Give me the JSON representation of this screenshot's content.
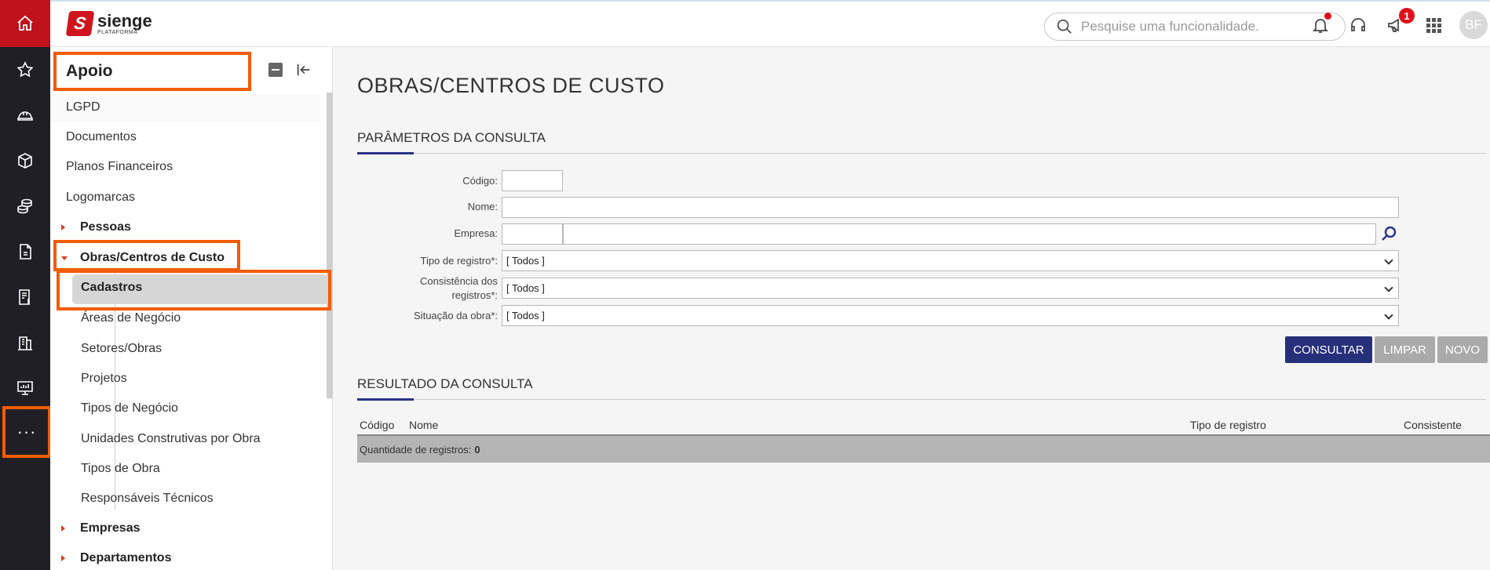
{
  "app": {
    "logo_name": "sienge",
    "logo_sub": "PLATAFORMA",
    "logo_mark": "S"
  },
  "rail": {
    "icons": [
      "home-icon",
      "star-icon",
      "helmet-icon",
      "box-icon",
      "coins-icon",
      "document-icon",
      "receipt-icon",
      "building-icon",
      "presentation-icon"
    ],
    "more_label": "···"
  },
  "topbar": {
    "search_placeholder": "Pesquise uma funcionalidade.",
    "announcement_count": "1",
    "avatar_initials": "BF"
  },
  "sidebar": {
    "title": "Apoio",
    "items": [
      {
        "label": "LGPD"
      },
      {
        "label": "Documentos"
      },
      {
        "label": "Planos Financeiros"
      },
      {
        "label": "Logomarcas"
      },
      {
        "label": "Pessoas"
      },
      {
        "label": "Obras/Centros de Custo"
      },
      {
        "label": "Cadastros"
      },
      {
        "label": "Áreas de Negócio"
      },
      {
        "label": "Setores/Obras"
      },
      {
        "label": "Projetos"
      },
      {
        "label": "Tipos de Negócio"
      },
      {
        "label": "Unidades Construtivas por Obra"
      },
      {
        "label": "Tipos de Obra"
      },
      {
        "label": "Responsáveis Técnicos"
      },
      {
        "label": "Empresas"
      },
      {
        "label": "Departamentos"
      }
    ]
  },
  "main": {
    "title": "OBRAS/CENTROS DE CUSTO",
    "params_title": "PARÂMETROS DA CONSULTA",
    "fields": {
      "codigo": "Código:",
      "nome": "Nome:",
      "empresa": "Empresa:",
      "tipo_registro": "Tipo de registro*:",
      "consistencia_1": "Consistência dos",
      "consistencia_2": "registros*:",
      "situacao": "Situação da obra*:"
    },
    "select_values": {
      "tipo_registro": "[ Todos ]",
      "consistencia": "[ Todos ]",
      "situacao": "[ Todos ]"
    },
    "buttons": {
      "consultar": "CONSULTAR",
      "limpar": "LIMPAR",
      "novo": "NOVO"
    },
    "result_title": "RESULTADO DA CONSULTA",
    "table": {
      "headers": [
        "Código",
        "Nome",
        "Tipo de registro",
        "Consistente"
      ],
      "count_label": "Quantidade de registros:",
      "count_value": "0"
    }
  },
  "colors": {
    "brand_red": "#c0121c",
    "highlight": "#f25c05",
    "primary_button": "#26307a"
  }
}
